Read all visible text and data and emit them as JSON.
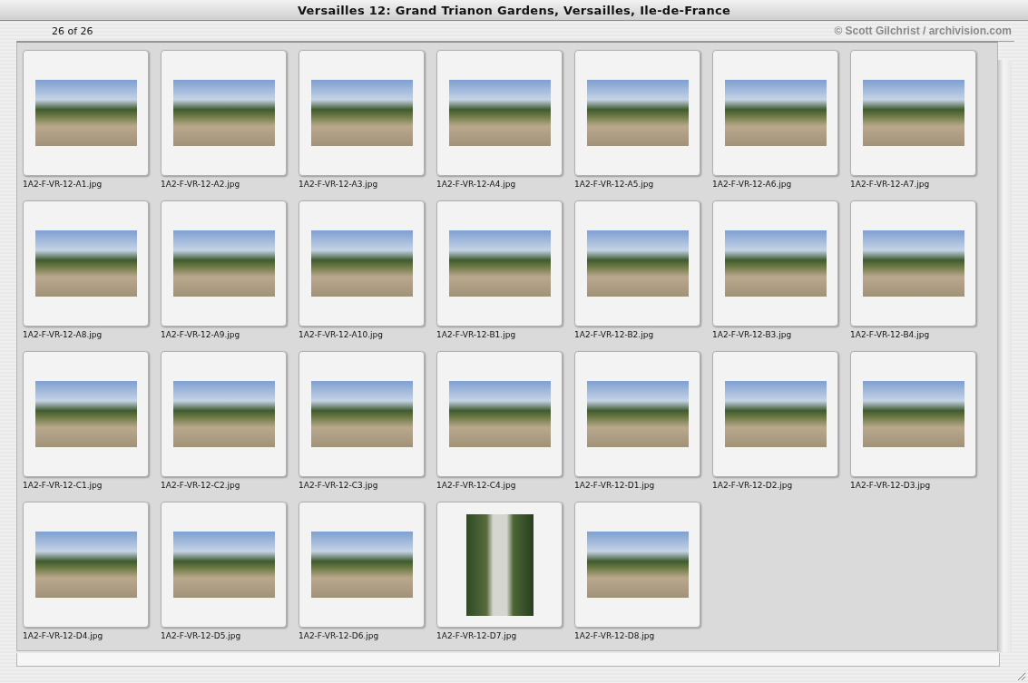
{
  "window": {
    "title": "Versailles 12: Grand Trianon Gardens, Versailles, Ile-de-France"
  },
  "counter": "26 of 26",
  "credit": "© Scott Gilchrist / archivision.com",
  "images": [
    {
      "filename": "1A2-F-VR-12-A1.jpg",
      "kind": "landscape"
    },
    {
      "filename": "1A2-F-VR-12-A2.jpg",
      "kind": "landscape"
    },
    {
      "filename": "1A2-F-VR-12-A3.jpg",
      "kind": "landscape"
    },
    {
      "filename": "1A2-F-VR-12-A4.jpg",
      "kind": "landscape"
    },
    {
      "filename": "1A2-F-VR-12-A5.jpg",
      "kind": "landscape"
    },
    {
      "filename": "1A2-F-VR-12-A6.jpg",
      "kind": "landscape"
    },
    {
      "filename": "1A2-F-VR-12-A7.jpg",
      "kind": "landscape"
    },
    {
      "filename": "1A2-F-VR-12-A8.jpg",
      "kind": "landscape"
    },
    {
      "filename": "1A2-F-VR-12-A9.jpg",
      "kind": "landscape"
    },
    {
      "filename": "1A2-F-VR-12-A10.jpg",
      "kind": "landscape"
    },
    {
      "filename": "1A2-F-VR-12-B1.jpg",
      "kind": "landscape"
    },
    {
      "filename": "1A2-F-VR-12-B2.jpg",
      "kind": "landscape"
    },
    {
      "filename": "1A2-F-VR-12-B3.jpg",
      "kind": "landscape"
    },
    {
      "filename": "1A2-F-VR-12-B4.jpg",
      "kind": "landscape"
    },
    {
      "filename": "1A2-F-VR-12-C1.jpg",
      "kind": "landscape"
    },
    {
      "filename": "1A2-F-VR-12-C2.jpg",
      "kind": "landscape"
    },
    {
      "filename": "1A2-F-VR-12-C3.jpg",
      "kind": "landscape"
    },
    {
      "filename": "1A2-F-VR-12-C4.jpg",
      "kind": "landscape"
    },
    {
      "filename": "1A2-F-VR-12-D1.jpg",
      "kind": "landscape"
    },
    {
      "filename": "1A2-F-VR-12-D2.jpg",
      "kind": "landscape"
    },
    {
      "filename": "1A2-F-VR-12-D3.jpg",
      "kind": "landscape"
    },
    {
      "filename": "1A2-F-VR-12-D4.jpg",
      "kind": "landscape"
    },
    {
      "filename": "1A2-F-VR-12-D5.jpg",
      "kind": "landscape"
    },
    {
      "filename": "1A2-F-VR-12-D6.jpg",
      "kind": "landscape"
    },
    {
      "filename": "1A2-F-VR-12-D7.jpg",
      "kind": "portrait"
    },
    {
      "filename": "1A2-F-VR-12-D8.jpg",
      "kind": "landscape"
    }
  ]
}
